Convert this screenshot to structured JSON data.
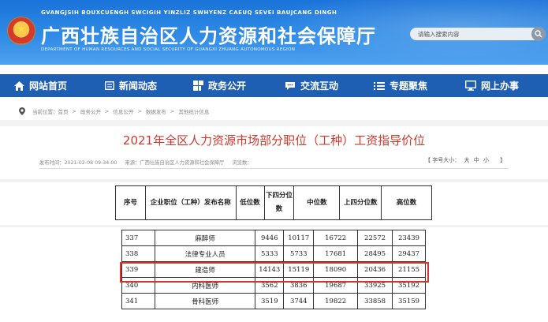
{
  "header": {
    "pinyin": "GVANGJSIH BOUXCUENGH SWCIGIH YINZLIZ SWHYENZ CAEUQ SEVEI BAUJCANG DINGH",
    "title": "广西壮族自治区人力资源和社会保障厅",
    "english": "DEPARTMENT OF HUMAN RESOURCES AND SOCIAL SECURITY OF GUANGXI ZHUANG AUTONOMOUS REGION",
    "search_placeholder": "请输入搜索内容"
  },
  "nav": [
    {
      "label": "网站首页",
      "icon": "home-icon"
    },
    {
      "label": "新闻动态",
      "icon": "newspaper-icon"
    },
    {
      "label": "政务公开",
      "icon": "grid-icon"
    },
    {
      "label": "交流互动",
      "icon": "chat-icon"
    },
    {
      "label": "专题聚焦",
      "icon": "list-icon"
    },
    {
      "label": "网上办事",
      "icon": "monitor-icon"
    }
  ],
  "breadcrumb": [
    "当前位置：首页",
    "政务公开",
    "信息公开",
    "数据发布",
    "其他统计信息"
  ],
  "article": {
    "title": "2021年全区人力资源市场部分职位（工种）工资指导价位",
    "publish_time": "发布时间：2021-02-08 09:34:00",
    "source": "来源：广西壮族自治区人力资源和社会保障厅",
    "views": "浏览数：",
    "fontsize_label": "【 字号大小：",
    "fontsize_large": "大",
    "fontsize_medium": "中",
    "fontsize_small": "小",
    "fontsize_close": "】"
  },
  "table": {
    "headers": [
      "序号",
      "企业职位（工种）发布名称",
      "低位数",
      "下四分位数",
      "中位数",
      "上四分位数",
      "高位数"
    ],
    "rows": [
      [
        "337",
        "麻醉师",
        "9446",
        "10117",
        "16722",
        "22572",
        "23439"
      ],
      [
        "338",
        "法律专业人员",
        "5333",
        "5733",
        "17681",
        "28495",
        "29437"
      ],
      [
        "339",
        "建造师",
        "14143",
        "15119",
        "18090",
        "20436",
        "21155"
      ],
      [
        "340",
        "内科医师",
        "3562",
        "3836",
        "19687",
        "33925",
        "35192"
      ],
      [
        "341",
        "骨科医师",
        "3519",
        "3744",
        "19822",
        "33858",
        "35159"
      ]
    ],
    "highlighted_row": "339"
  },
  "colors": {
    "header_blue": "#1a73d9",
    "nav_blue": "#1e5fb3",
    "title_red": "#d2372b",
    "highlight_red": "#d7362c"
  }
}
